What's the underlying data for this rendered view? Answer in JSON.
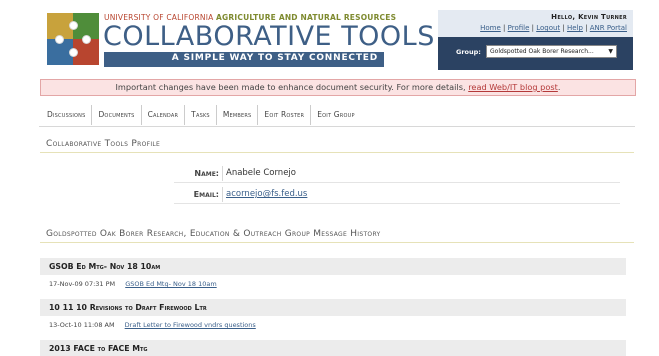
{
  "header": {
    "university_line_prefix": "UNIVERSITY OF CALIFORNIA",
    "university_line_bold": "AGRICULTURE AND NATURAL RESOURCES",
    "brand": "COLLABORATIVE TOOLS",
    "tagline": "A SIMPLE WAY TO STAY CONNECTED"
  },
  "user": {
    "greeting": "Hello, Kevin Turner",
    "links": [
      "Home",
      "Profile",
      "Logout",
      "Help",
      "ANR Portal"
    ],
    "group_label": "Group:",
    "group_selected": "Goldspotted Oak Borer Research..."
  },
  "alert": {
    "text": "Important changes have been made to enhance document security. For more details, ",
    "link": "read Web/IT blog post",
    "suffix": "."
  },
  "tabs": [
    "Discussions",
    "Documents",
    "Calendar",
    "Tasks",
    "Members",
    "Eoit Roster",
    "Eoit Group"
  ],
  "profile": {
    "title": "Collaborative Tools Profile",
    "name_label": "Name:",
    "name_value": "Anabele Cornejo",
    "email_label": "Email:",
    "email_value": "acornejo@fs.fed.us"
  },
  "history": {
    "title": "Goldspotted Oak Borer Research, Education & Outreach Group Message History",
    "messages": [
      {
        "title": "GSOB Ed Mtg- Nov 18 10am",
        "date": "17-Nov-09 07:31 PM",
        "link": "GSOB Ed Mtg- Nov 18 10am"
      },
      {
        "title": "10 11 10 Revisions to Draft Firewood Ltr",
        "date": "13-Oct-10 11:08 AM",
        "link": "Draft Letter to Firewood vndrs questions"
      },
      {
        "title": "2013 FACE to FACE Mtg",
        "date": "",
        "link": ""
      }
    ]
  },
  "colors": {
    "brand_blue": "#3e5f86",
    "userbox_navy": "#2b4262",
    "alert_bg": "#fbe3e3",
    "link": "#3a5f8a"
  }
}
